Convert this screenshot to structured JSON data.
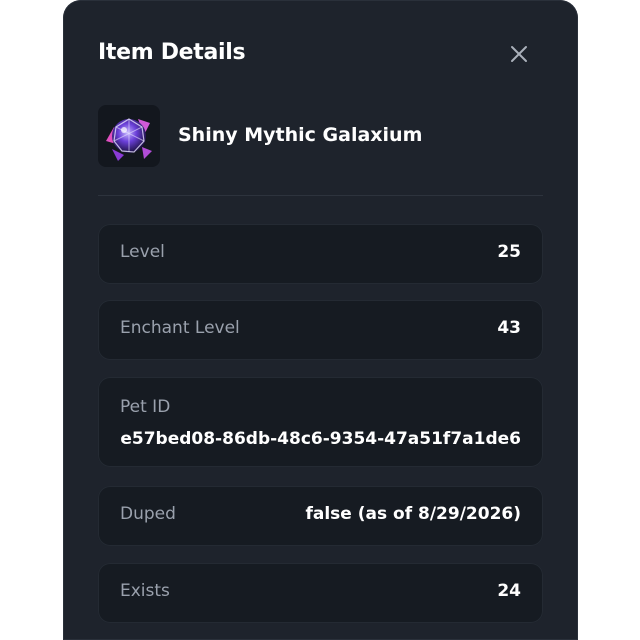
{
  "dialog": {
    "title": "Item Details",
    "close_icon": "close-icon",
    "item": {
      "name": "Shiny Mythic Galaxium",
      "image_icon": "galaxium-pet-icon"
    },
    "rows": {
      "level": {
        "label": "Level",
        "value": "25"
      },
      "enchant_level": {
        "label": "Enchant Level",
        "value": "43"
      },
      "pet_id": {
        "label": "Pet ID",
        "value": "e57bed08-86db-48c6-9354-47a51f7a1de6"
      },
      "duped": {
        "label": "Duped",
        "value": "false (as of 8/29/2026)"
      },
      "exists": {
        "label": "Exists",
        "value": "24"
      }
    }
  },
  "colors": {
    "modal_bg": "#1e232c",
    "row_bg": "#161b22",
    "label": "#9aa1ad",
    "value": "#ffffff"
  }
}
